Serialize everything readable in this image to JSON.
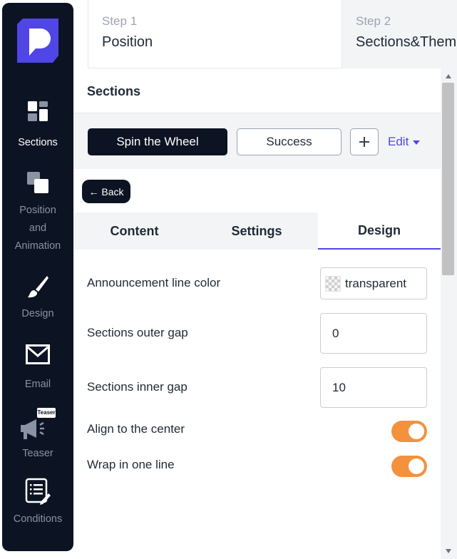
{
  "sidebar": {
    "items": [
      {
        "label": "Sections",
        "icon": "sections-icon",
        "active": true
      },
      {
        "label": "Position",
        "label2": "and",
        "label3": "Animation",
        "icon": "position-animation-icon"
      },
      {
        "label": "Design",
        "icon": "brush-icon"
      },
      {
        "label": "Email",
        "icon": "envelope-icon"
      },
      {
        "label": "Teaser",
        "badge": "Teaser",
        "icon": "megaphone-icon"
      },
      {
        "label": "Conditions",
        "icon": "conditions-icon"
      }
    ]
  },
  "steps": [
    {
      "sub": "Step 1",
      "title": "Position"
    },
    {
      "sub": "Step 2",
      "title": "Sections&Themes"
    }
  ],
  "panel": {
    "title": "Sections",
    "section_tabs": [
      {
        "label": "Spin the Wheel",
        "active": true
      },
      {
        "label": "Success",
        "active": false
      }
    ],
    "add_symbol": "+",
    "edit_label": "Edit",
    "back_label": "← Back",
    "subtabs": [
      "Content",
      "Settings",
      "Design"
    ],
    "active_subtab": "Design",
    "settings": {
      "announcement_color_label": "Announcement line color",
      "announcement_color_value": "transparent",
      "outer_gap_label": "Sections outer gap",
      "outer_gap_value": "0",
      "inner_gap_label": "Sections inner gap",
      "inner_gap_value": "10",
      "align_center_label": "Align to the center",
      "align_center_on": true,
      "wrap_line_label": "Wrap in one line",
      "wrap_line_on": true
    }
  },
  "colors": {
    "sidebar_bg": "#0c1322",
    "accent": "#4f46e5",
    "toggle_on": "#f4913d",
    "logo": "#4f46e5"
  }
}
